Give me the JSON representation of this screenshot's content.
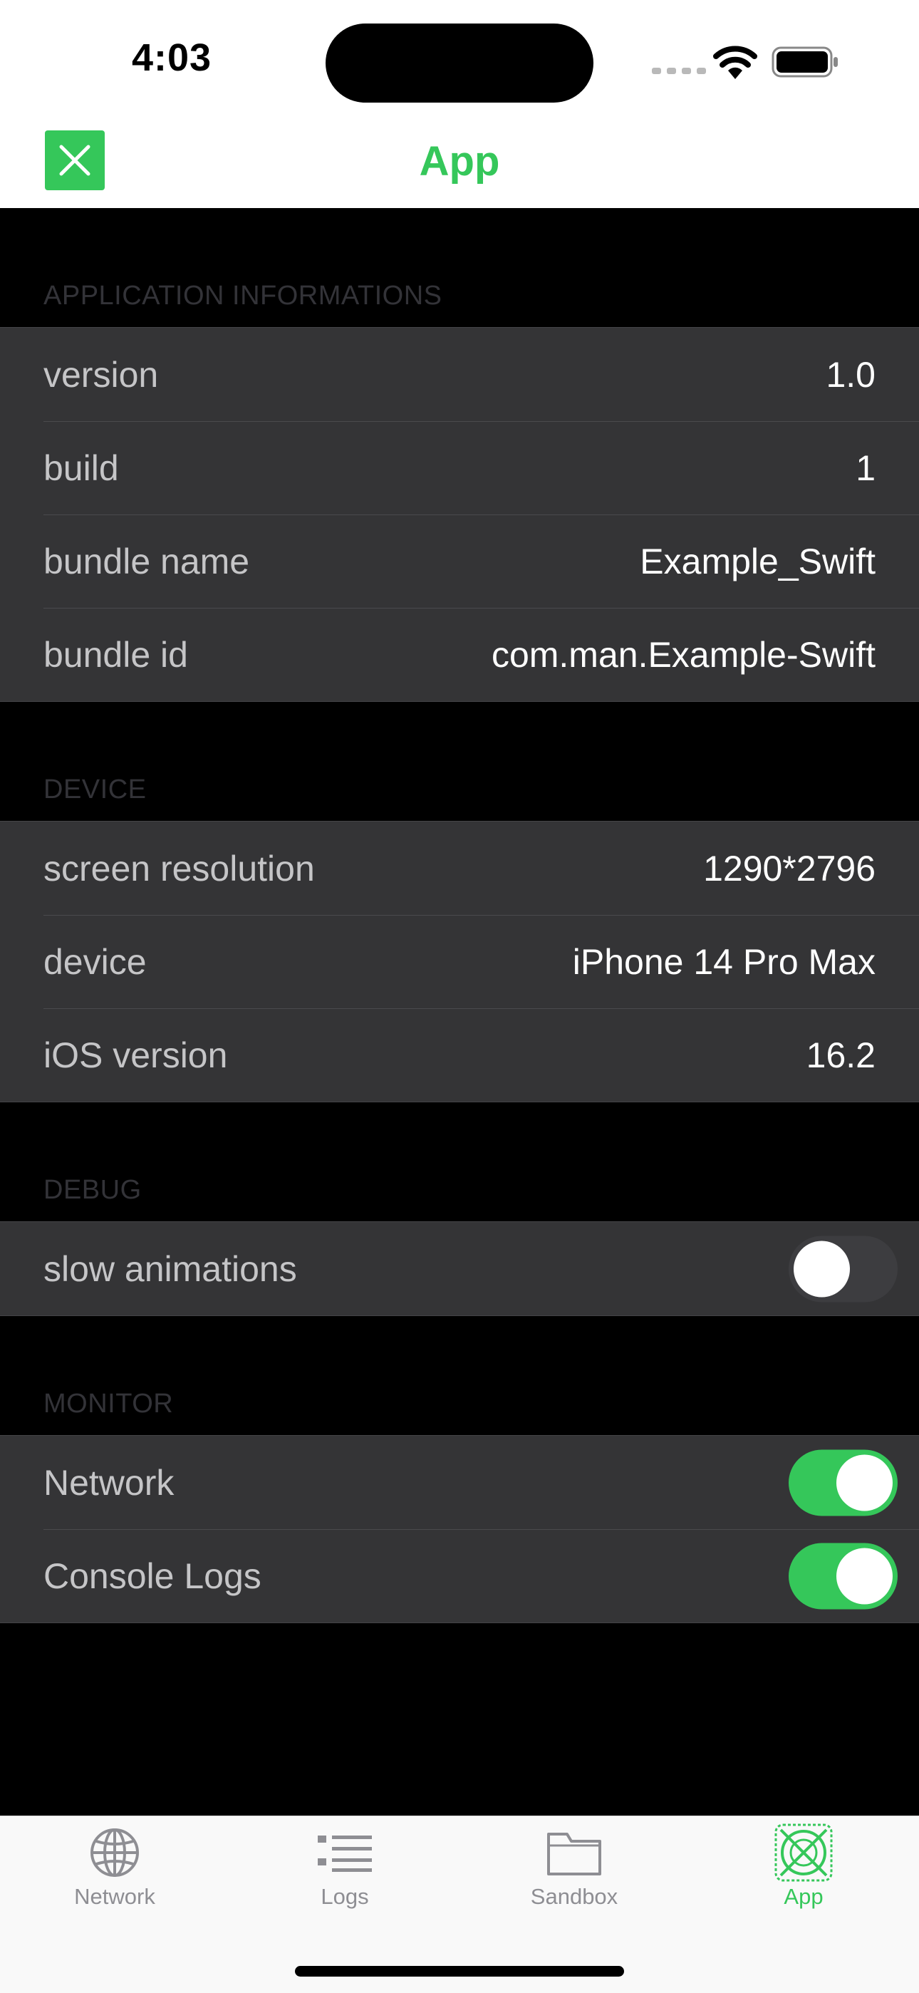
{
  "status_bar": {
    "time": "4:03"
  },
  "navbar": {
    "title": "App",
    "close_icon": "close-icon"
  },
  "sections": [
    {
      "header": "APPLICATION INFORMATIONS",
      "rows": [
        {
          "label": "version",
          "value": "1.0"
        },
        {
          "label": "build",
          "value": "1"
        },
        {
          "label": "bundle name",
          "value": "Example_Swift"
        },
        {
          "label": "bundle id",
          "value": "com.man.Example-Swift"
        }
      ]
    },
    {
      "header": "DEVICE",
      "rows": [
        {
          "label": "screen resolution",
          "value": "1290*2796"
        },
        {
          "label": "device",
          "value": "iPhone 14 Pro Max"
        },
        {
          "label": "iOS version",
          "value": "16.2"
        }
      ]
    },
    {
      "header": "DEBUG",
      "rows": [
        {
          "label": "slow animations",
          "toggle": false
        }
      ]
    },
    {
      "header": "MONITOR",
      "rows": [
        {
          "label": "Network",
          "toggle": true
        },
        {
          "label": "Console Logs",
          "toggle": true
        }
      ]
    }
  ],
  "tabbar": {
    "tabs": [
      {
        "label": "Network",
        "icon": "globe-icon",
        "active": false
      },
      {
        "label": "Logs",
        "icon": "list-icon",
        "active": false
      },
      {
        "label": "Sandbox",
        "icon": "folder-icon",
        "active": false
      },
      {
        "label": "App",
        "icon": "app-icon",
        "active": true
      }
    ]
  },
  "colors": {
    "accent": "#35c75a",
    "cell_background": "#343436",
    "background": "#000000"
  }
}
